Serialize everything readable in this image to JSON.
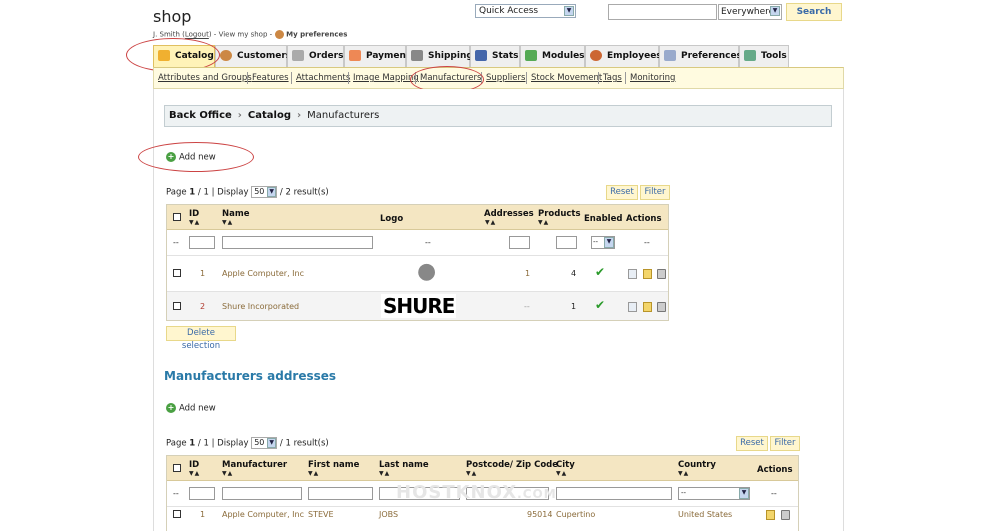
{
  "header": {
    "shop_title": "shop",
    "user_name": "J. Smith",
    "logout_label": "Logout",
    "view_shop": "View my shop",
    "my_preferences": "My preferences",
    "quick_access": "Quick Access",
    "search_scope": "Everywhere",
    "search_button": "Search"
  },
  "tabs": [
    {
      "label": "Catalog",
      "icon": "folder-icon",
      "color": "#f0b030"
    },
    {
      "label": "Customers",
      "icon": "user-icon",
      "color": "#c84"
    },
    {
      "label": "Orders",
      "icon": "cart-icon",
      "color": "#999"
    },
    {
      "label": "Payment",
      "icon": "payment-icon",
      "color": "#e85"
    },
    {
      "label": "Shipping",
      "icon": "truck-icon",
      "color": "#888"
    },
    {
      "label": "Stats",
      "icon": "chart-icon",
      "color": "#46a"
    },
    {
      "label": "Modules",
      "icon": "puzzle-icon",
      "color": "#5a5"
    },
    {
      "label": "Employees",
      "icon": "employee-icon",
      "color": "#c63"
    },
    {
      "label": "Preferences",
      "icon": "preferences-icon",
      "color": "#9ac"
    },
    {
      "label": "Tools",
      "icon": "wrench-icon",
      "color": "#6a8"
    }
  ],
  "subnav": [
    "Attributes and Groups",
    "Features",
    "Attachments",
    "Image Mapping",
    "Manufacturers",
    "Suppliers",
    "Stock Movement",
    "Tags",
    "Monitoring"
  ],
  "breadcrumb": {
    "root": "Back Office",
    "section": "Catalog",
    "current": "Manufacturers"
  },
  "manufacturers": {
    "add_new": "Add new",
    "pager": {
      "page_label": "Page",
      "page": "1",
      "sep": "/",
      "total_pages": "1",
      "display_label": "| Display",
      "per_page": "50",
      "results": "/ 2 result(s)"
    },
    "reset": "Reset",
    "filter": "Filter",
    "columns": {
      "id": "ID",
      "name": "Name",
      "logo": "Logo",
      "addresses": "Addresses",
      "products": "Products",
      "enabled": "Enabled",
      "actions": "Actions"
    },
    "filter_placeholder": "--",
    "rows": [
      {
        "id": "1",
        "name": "Apple Computer, Inc",
        "logo": "apple-logo",
        "addresses": "1",
        "products": "4",
        "enabled": true
      },
      {
        "id": "2",
        "name": "Shure Incorporated",
        "logo": "SHURE",
        "addresses": "--",
        "products": "1",
        "enabled": true
      }
    ],
    "delete_selection": "Delete selection"
  },
  "addresses": {
    "title": "Manufacturers addresses",
    "add_new": "Add new",
    "pager": {
      "page_label": "Page",
      "page": "1",
      "sep": "/",
      "total_pages": "1",
      "display_label": "| Display",
      "per_page": "50",
      "results": "/ 1 result(s)"
    },
    "reset": "Reset",
    "filter": "Filter",
    "columns": {
      "id": "ID",
      "manufacturer": "Manufacturer",
      "first_name": "First name",
      "last_name": "Last name",
      "postcode": "Postcode/ Zip Code",
      "city": "City",
      "country": "Country",
      "actions": "Actions"
    },
    "filter_placeholder": "--",
    "rows": [
      {
        "id": "1",
        "manufacturer": "Apple Computer, Inc",
        "first_name": "STEVE",
        "last_name": "JOBS",
        "postcode": "95014",
        "city": "Cupertino",
        "country": "United States"
      }
    ]
  },
  "watermark": "HOSTKNOX",
  "watermark_suffix": ".COM"
}
